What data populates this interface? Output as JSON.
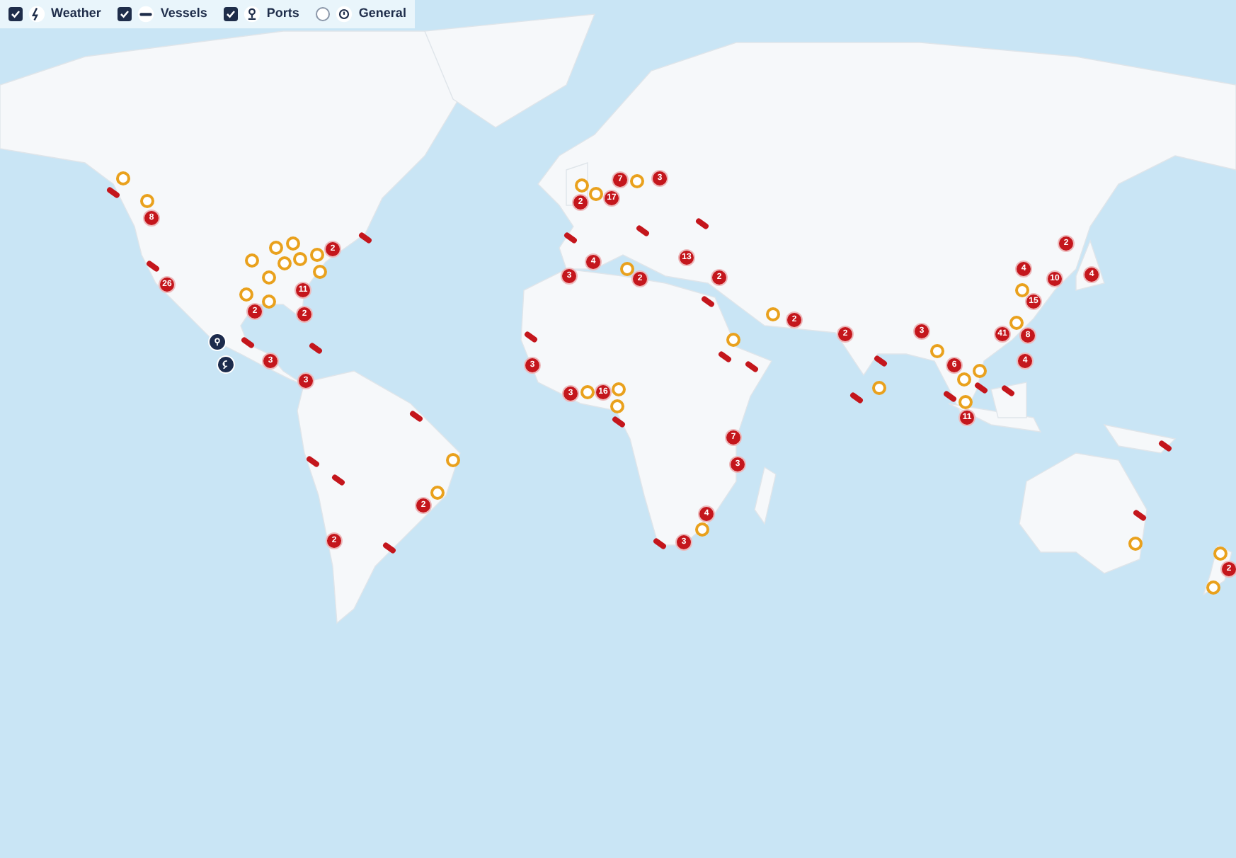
{
  "filters": [
    {
      "kind": "weather",
      "label": "Weather",
      "checked": true
    },
    {
      "kind": "vessels",
      "label": "Vessels",
      "checked": true
    },
    {
      "kind": "ports",
      "label": "Ports",
      "checked": true
    },
    {
      "kind": "general",
      "label": "General",
      "checked": false
    }
  ],
  "map": {
    "pins": [
      {
        "kind": "ring"
      },
      {
        "kind": "vessel"
      },
      {
        "kind": "ring"
      },
      {
        "kind": "count",
        "label": "8"
      },
      {
        "kind": "vessel"
      },
      {
        "kind": "count",
        "label": "26"
      },
      {
        "kind": "ring"
      },
      {
        "kind": "ring"
      },
      {
        "kind": "ring"
      },
      {
        "kind": "ring"
      },
      {
        "kind": "ring"
      },
      {
        "kind": "ring"
      },
      {
        "kind": "count",
        "label": "2"
      },
      {
        "kind": "ring"
      },
      {
        "kind": "ring"
      },
      {
        "kind": "ring"
      },
      {
        "kind": "ring"
      },
      {
        "kind": "count",
        "label": "2"
      },
      {
        "kind": "count",
        "label": "11"
      },
      {
        "kind": "count",
        "label": "2"
      },
      {
        "kind": "vessel"
      },
      {
        "kind": "vessel"
      },
      {
        "kind": "vessel"
      },
      {
        "kind": "count",
        "label": "3"
      },
      {
        "kind": "count",
        "label": "3"
      },
      {
        "kind": "port"
      },
      {
        "kind": "storm"
      },
      {
        "kind": "vessel"
      },
      {
        "kind": "ring"
      },
      {
        "kind": "ring"
      },
      {
        "kind": "count",
        "label": "2"
      },
      {
        "kind": "vessel"
      },
      {
        "kind": "vessel"
      },
      {
        "kind": "count",
        "label": "2"
      },
      {
        "kind": "vessel"
      },
      {
        "kind": "ring"
      },
      {
        "kind": "count",
        "label": "2"
      },
      {
        "kind": "ring"
      },
      {
        "kind": "count",
        "label": "17"
      },
      {
        "kind": "count",
        "label": "7"
      },
      {
        "kind": "ring"
      },
      {
        "kind": "count",
        "label": "3"
      },
      {
        "kind": "vessel"
      },
      {
        "kind": "vessel"
      },
      {
        "kind": "vessel"
      },
      {
        "kind": "count",
        "label": "4"
      },
      {
        "kind": "count",
        "label": "3"
      },
      {
        "kind": "ring"
      },
      {
        "kind": "count",
        "label": "2"
      },
      {
        "kind": "count",
        "label": "13"
      },
      {
        "kind": "count",
        "label": "2"
      },
      {
        "kind": "vessel"
      },
      {
        "kind": "ring"
      },
      {
        "kind": "count",
        "label": "2"
      },
      {
        "kind": "ring"
      },
      {
        "kind": "vessel"
      },
      {
        "kind": "vessel"
      },
      {
        "kind": "vessel"
      },
      {
        "kind": "count",
        "label": "3"
      },
      {
        "kind": "count",
        "label": "3"
      },
      {
        "kind": "ring"
      },
      {
        "kind": "ring"
      },
      {
        "kind": "count",
        "label": "16"
      },
      {
        "kind": "ring"
      },
      {
        "kind": "vessel"
      },
      {
        "kind": "count",
        "label": "7"
      },
      {
        "kind": "count",
        "label": "3"
      },
      {
        "kind": "ring"
      },
      {
        "kind": "count",
        "label": "4"
      },
      {
        "kind": "vessel"
      },
      {
        "kind": "count",
        "label": "3"
      },
      {
        "kind": "count",
        "label": "2"
      },
      {
        "kind": "vessel"
      },
      {
        "kind": "count",
        "label": "3"
      },
      {
        "kind": "ring"
      },
      {
        "kind": "ring"
      },
      {
        "kind": "vessel"
      },
      {
        "kind": "count",
        "label": "6"
      },
      {
        "kind": "ring"
      },
      {
        "kind": "ring"
      },
      {
        "kind": "vessel"
      },
      {
        "kind": "vessel"
      },
      {
        "kind": "ring"
      },
      {
        "kind": "count",
        "label": "11"
      },
      {
        "kind": "vessel"
      },
      {
        "kind": "count",
        "label": "4"
      },
      {
        "kind": "count",
        "label": "2"
      },
      {
        "kind": "count",
        "label": "10"
      },
      {
        "kind": "count",
        "label": "4"
      },
      {
        "kind": "ring"
      },
      {
        "kind": "count",
        "label": "15"
      },
      {
        "kind": "ring"
      },
      {
        "kind": "count",
        "label": "41"
      },
      {
        "kind": "count",
        "label": "8"
      },
      {
        "kind": "count",
        "label": "4"
      },
      {
        "kind": "vessel"
      },
      {
        "kind": "vessel"
      },
      {
        "kind": "ring"
      },
      {
        "kind": "ring"
      },
      {
        "kind": "count",
        "label": "2"
      },
      {
        "kind": "ring"
      }
    ]
  }
}
